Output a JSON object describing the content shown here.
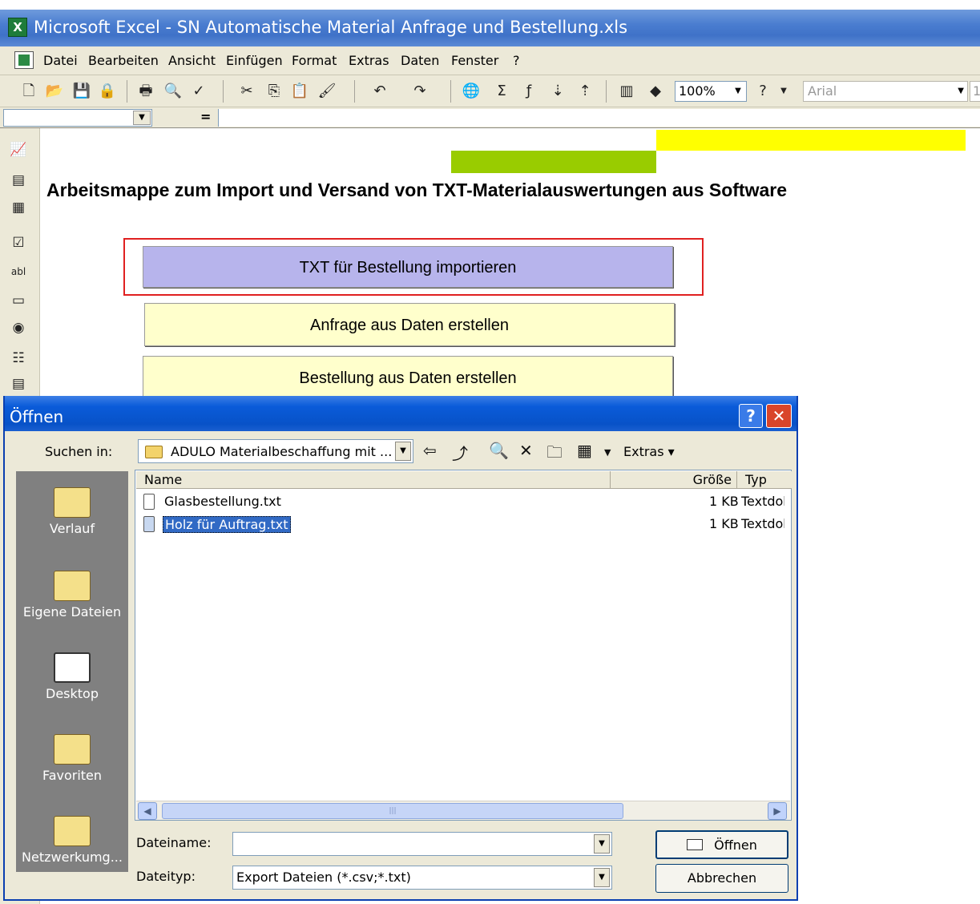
{
  "window": {
    "title": "Microsoft Excel - SN Automatische Material Anfrage und Bestellung.xls"
  },
  "menu": [
    "Datei",
    "Bearbeiten",
    "Ansicht",
    "Einfügen",
    "Format",
    "Extras",
    "Daten",
    "Fenster",
    "?"
  ],
  "toolbar": {
    "zoom": "100%",
    "font": "Arial",
    "size": "1"
  },
  "formula": {
    "equals": "="
  },
  "sheet": {
    "heading": "Arbeitsmappe zum Import und Versand von TXT-Materialauswertungen aus Software",
    "buttons": [
      "TXT für Bestellung importieren",
      "Anfrage aus Daten erstellen",
      "Bestellung aus Daten erstellen"
    ],
    "colors": {
      "yellow": "#ffff00",
      "green": "#99cc00",
      "selected_button": "#b7b4ec",
      "button": "#ffffcc",
      "highlight_frame": "#e02020"
    }
  },
  "dialog": {
    "title": "Öffnen",
    "look_in_label": "Suchen in:",
    "look_in_value": "ADULO Materialbeschaffung mit ...",
    "extras_label": "Extras",
    "places": [
      "Verlauf",
      "Eigene Dateien",
      "Desktop",
      "Favoriten",
      "Netzwerkumg..."
    ],
    "columns": {
      "name": "Name",
      "size": "Größe",
      "type": "Typ"
    },
    "files": [
      {
        "name": "Glasbestellung.txt",
        "size": "1 KB",
        "type": "Textdok",
        "selected": false
      },
      {
        "name": "Holz für Auftrag.txt",
        "size": "1 KB",
        "type": "Textdok",
        "selected": true
      }
    ],
    "filename_label": "Dateiname:",
    "filename_value": "",
    "filetype_label": "Dateityp:",
    "filetype_value": "Export Dateien (*.csv;*.txt)",
    "open_button": "Öffnen",
    "cancel_button": "Abbrechen"
  }
}
